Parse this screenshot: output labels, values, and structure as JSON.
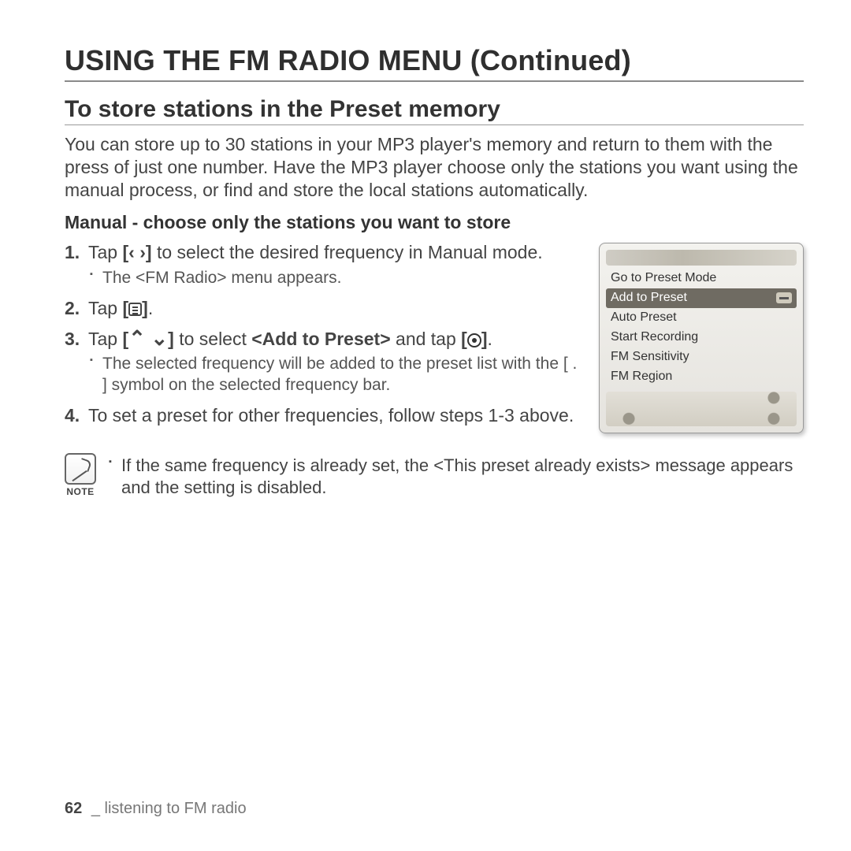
{
  "main_title": "USING THE FM RADIO MENU (Continued)",
  "sub_title": "To store stations in the Preset memory",
  "intro": "You can store up to 30 stations in your MP3 player's memory and return to them with the press of just one number. Have the MP3 player choose only the stations you want using the manual process, or find and store the local stations automatically.",
  "method_title": "Manual - choose only the stations you want to store",
  "steps": {
    "s1": {
      "num": "1.",
      "pre": "Tap ",
      "brL": "[",
      "arrL": "‹",
      "gap": "  ",
      "arrR": "›",
      "brR": "]",
      "post": " to select the desired frequency in Manual mode.",
      "sub": "The <FM Radio> menu appears."
    },
    "s2": {
      "num": "2.",
      "pre": "Tap ",
      "brL": "[",
      "brR": "]",
      "post": "."
    },
    "s3": {
      "num": "3.",
      "pre": "Tap ",
      "brL": "[",
      "up": "ˆ",
      "dn": "ˇ",
      "brR": "]",
      "mid": " to select ",
      "bold": "<Add to Preset>",
      "post2": " and tap ",
      "brL2": "[",
      "brR2": "]",
      "end": ".",
      "sub": "The selected frequency will be added to the preset list with the [ . ] symbol on the selected frequency bar."
    },
    "s4": {
      "num": "4.",
      "text": "To set a preset for other frequencies, follow steps 1-3 above."
    }
  },
  "device_menu": {
    "items": [
      "Go to Preset Mode",
      "Add to Preset",
      "Auto Preset",
      "Start Recording",
      "FM Sensitivity",
      "FM Region"
    ],
    "selected_index": 1
  },
  "note": {
    "label": "NOTE",
    "text": "If the same frequency is already set, the <This preset already exists> message appears and the setting is disabled."
  },
  "footer": {
    "page": "62",
    "sep": "_",
    "chapter": "listening to FM radio"
  }
}
